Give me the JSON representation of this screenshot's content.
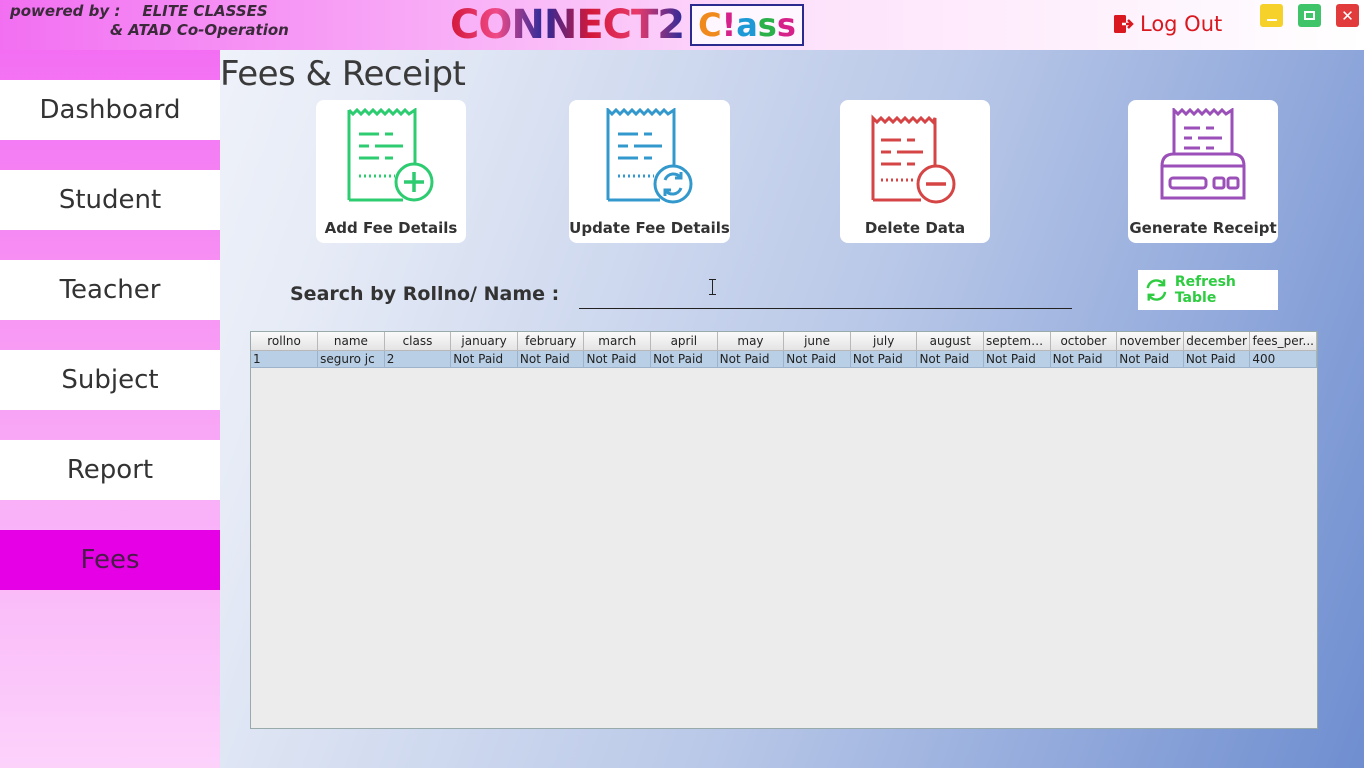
{
  "header": {
    "powered_line1": "powered by :",
    "powered_company": "ELITE CLASSES",
    "powered_line2": "& ATAD Co-Operation",
    "logo_main": "CONNECT2",
    "logo_class": [
      "C",
      "!",
      "a",
      "s",
      "s"
    ],
    "logout_label": "Log Out"
  },
  "sidebar": {
    "items": [
      {
        "label": "Dashboard"
      },
      {
        "label": "Student"
      },
      {
        "label": "Teacher"
      },
      {
        "label": "Subject"
      },
      {
        "label": "Report"
      },
      {
        "label": "Fees"
      }
    ],
    "active": "Fees"
  },
  "main": {
    "title": "Fees & Receipt",
    "actions": [
      {
        "label": "Add Fee Details",
        "icon": "add-receipt-icon",
        "color": "#2ecc71"
      },
      {
        "label": "Update Fee Details",
        "icon": "update-receipt-icon",
        "color": "#3399cc"
      },
      {
        "label": "Delete Data",
        "icon": "delete-receipt-icon",
        "color": "#d64545"
      },
      {
        "label": "Generate Receipt",
        "icon": "printer-icon",
        "color": "#9b4fb8"
      }
    ],
    "search_label": "Search by Rollno/ Name :",
    "search_value": "",
    "refresh_label": "Refresh Table"
  },
  "table": {
    "columns": [
      "rollno",
      "name",
      "class",
      "january",
      "february",
      "march",
      "april",
      "may",
      "june",
      "july",
      "august",
      "september",
      "october",
      "november",
      "december",
      "fees_per..."
    ],
    "rows": [
      [
        "1",
        "seguro jc",
        "2",
        "Not Paid",
        "Not Paid",
        "Not Paid",
        "Not Paid",
        "Not Paid",
        "Not Paid",
        "Not Paid",
        "Not Paid",
        "Not Paid",
        "Not Paid",
        "Not Paid",
        "Not Paid",
        "400"
      ]
    ]
  }
}
